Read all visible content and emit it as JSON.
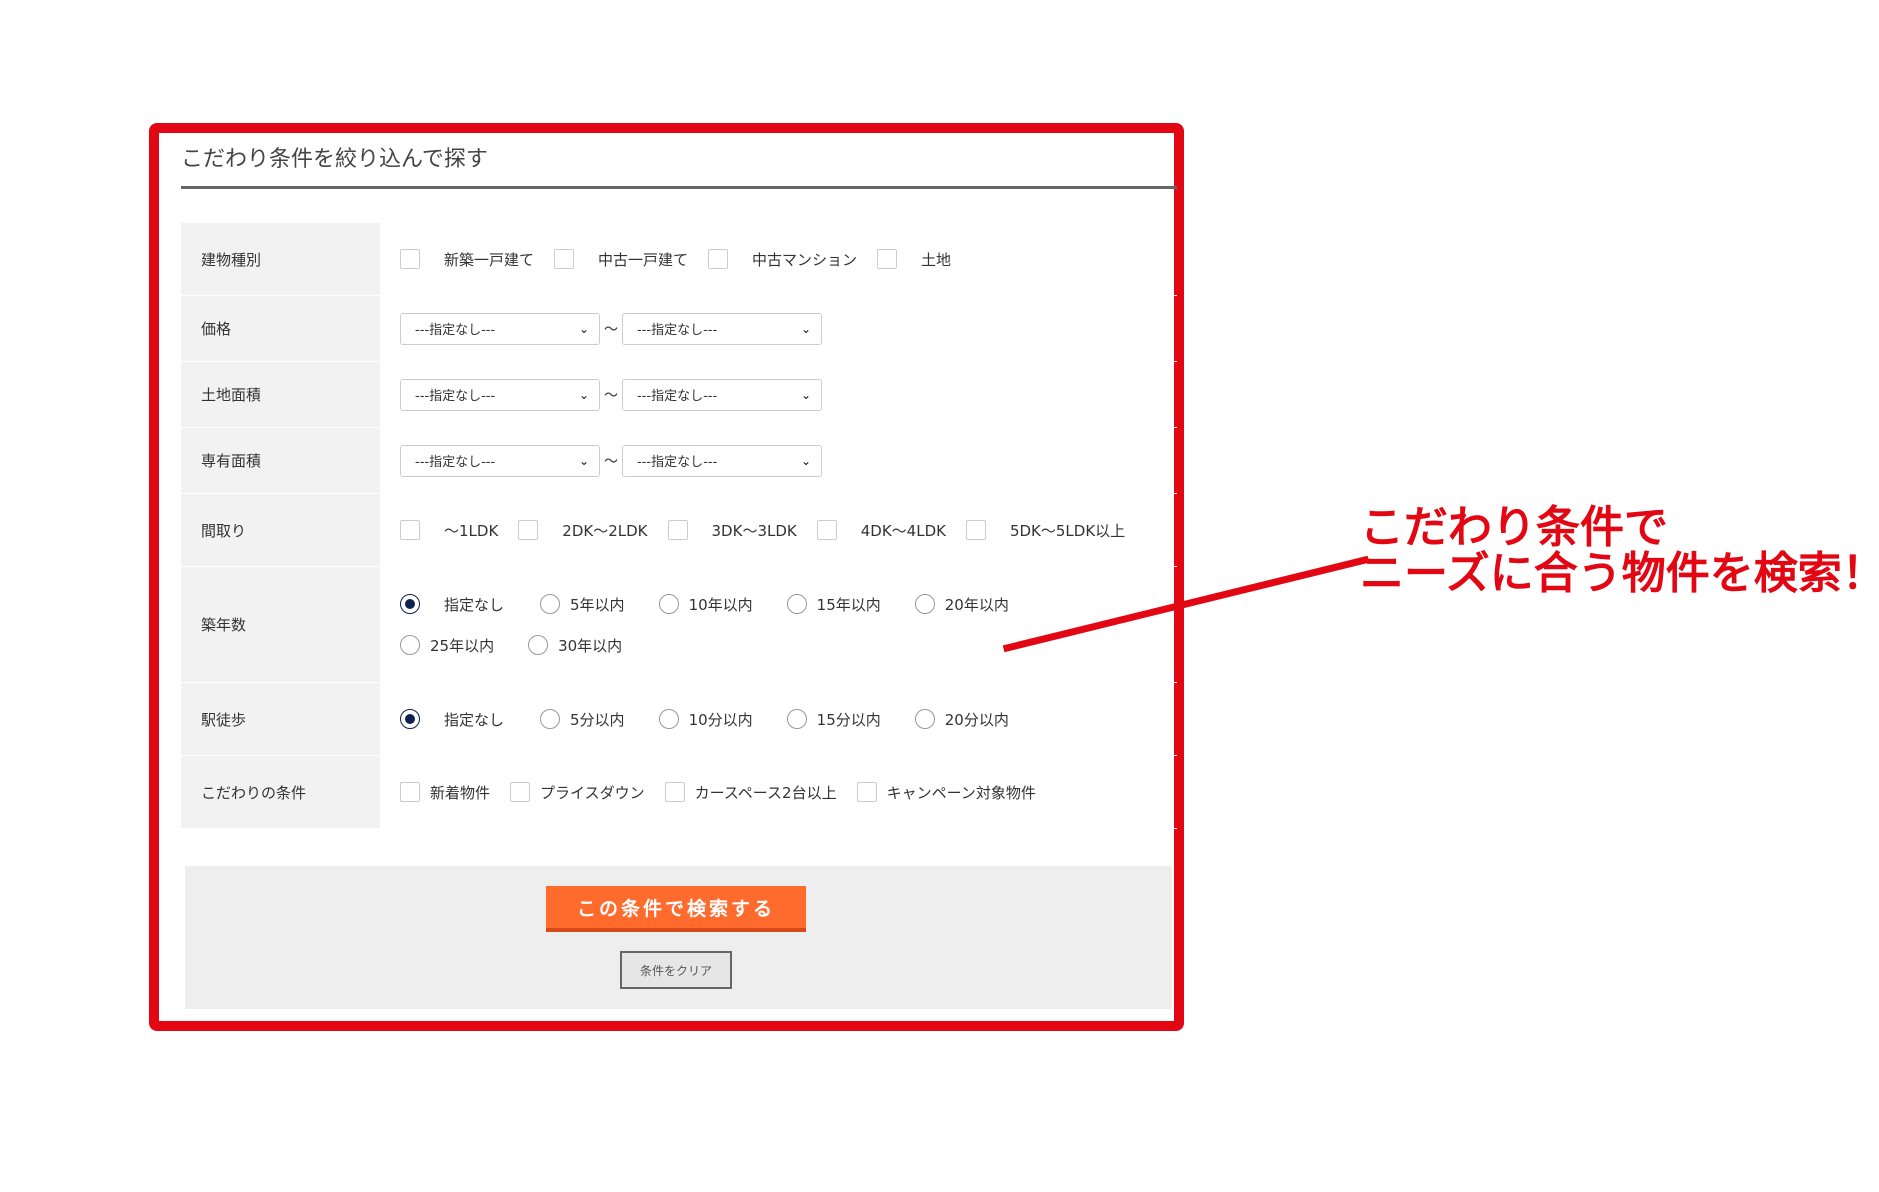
{
  "panel": {
    "title": "こだわり条件を絞り込んで探す"
  },
  "rows": {
    "building_type": {
      "label": "建物種別",
      "options": [
        "新築一戸建て",
        "中古一戸建て",
        "中古マンション",
        "土地"
      ]
    },
    "price": {
      "label": "価格",
      "from": "---指定なし---",
      "to": "---指定なし---"
    },
    "land_area": {
      "label": "土地面積",
      "from": "---指定なし---",
      "to": "---指定なし---"
    },
    "floor_area": {
      "label": "専有面積",
      "from": "---指定なし---",
      "to": "---指定なし---"
    },
    "layout": {
      "label": "間取り",
      "options": [
        "～1LDK",
        "2DK～2LDK",
        "3DK～3LDK",
        "4DK～4LDK",
        "5DK～5LDK以上"
      ]
    },
    "age": {
      "label": "築年数",
      "options": [
        "指定なし",
        "5年以内",
        "10年以内",
        "15年以内",
        "20年以内",
        "25年以内",
        "30年以内"
      ],
      "selected": "指定なし"
    },
    "walk": {
      "label": "駅徒歩",
      "options": [
        "指定なし",
        "5分以内",
        "10分以内",
        "15分以内",
        "20分以内"
      ],
      "selected": "指定なし"
    },
    "features": {
      "label": "こだわりの条件",
      "options": [
        "新着物件",
        "プライスダウン",
        "カースペース2台以上",
        "キャンペーン対象物件"
      ]
    }
  },
  "range_separator": "～",
  "buttons": {
    "search": "この条件で検索する",
    "clear": "条件をクリア"
  },
  "callout": {
    "line1": "こだわり条件で",
    "line2": "ニーズに合う物件を検索！"
  },
  "colors": {
    "accent_red": "#e30613",
    "search_button": "#ff6a2d",
    "radio_selected": "#0d2152"
  }
}
